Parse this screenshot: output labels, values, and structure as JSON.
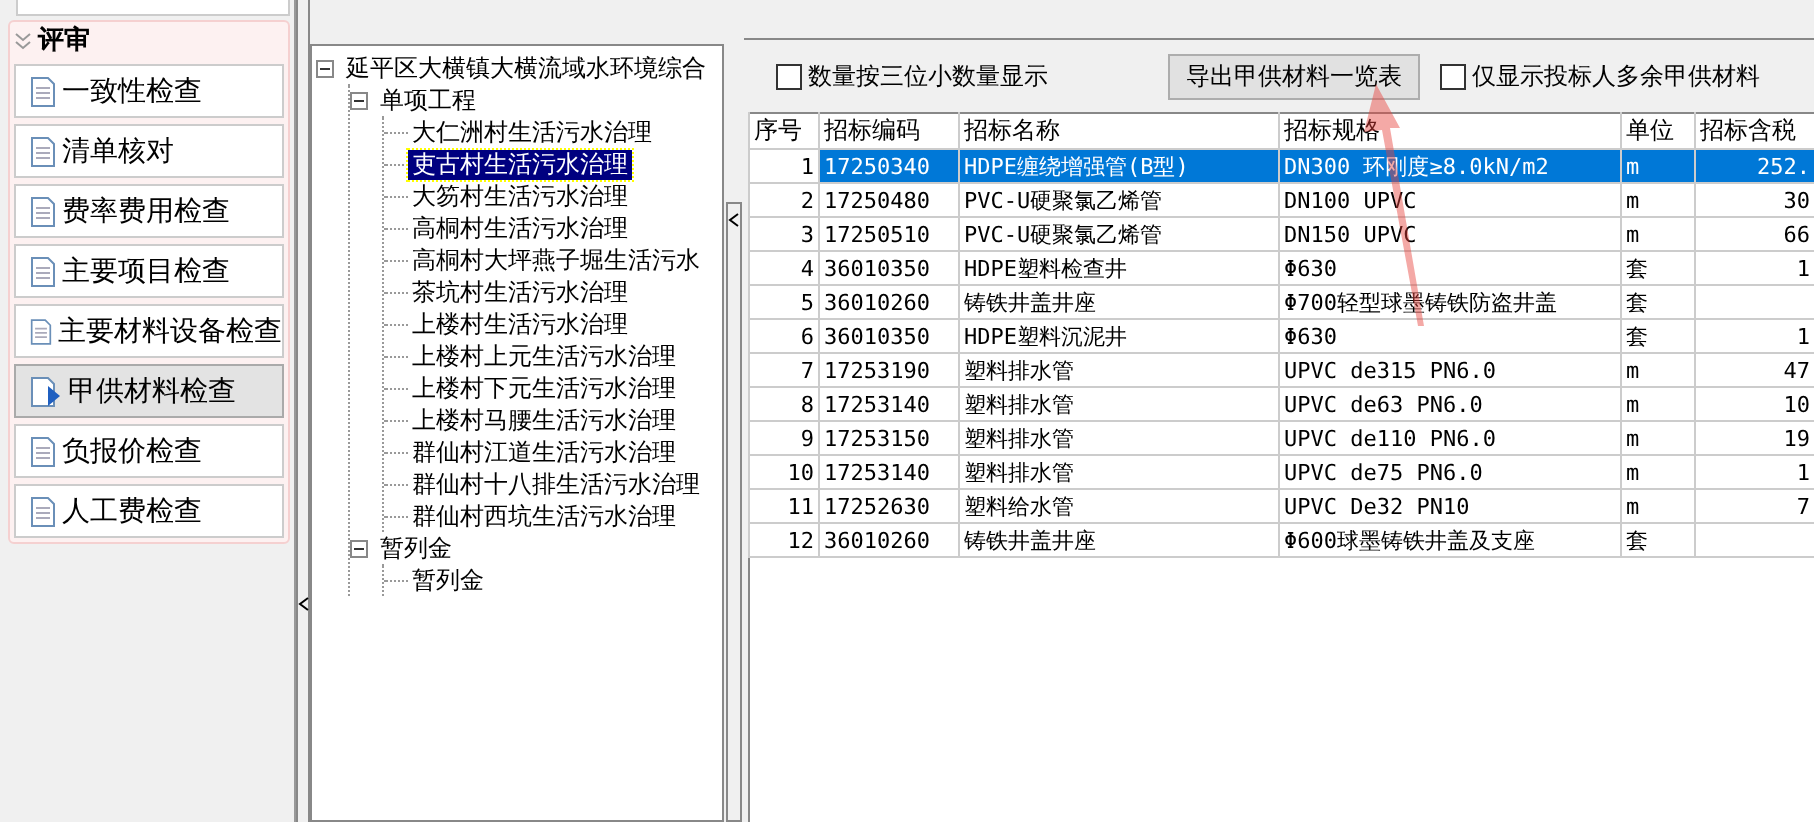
{
  "sidebar": {
    "section": "评审",
    "items": [
      {
        "label": "一致性检查",
        "selected": false
      },
      {
        "label": "清单核对",
        "selected": false
      },
      {
        "label": "费率费用检查",
        "selected": false
      },
      {
        "label": "主要项目检查",
        "selected": false
      },
      {
        "label": "主要材料设备检查",
        "selected": false
      },
      {
        "label": "甲供材料检查",
        "selected": true
      },
      {
        "label": "负报价检查",
        "selected": false
      },
      {
        "label": "人工费检查",
        "selected": false
      }
    ]
  },
  "tree": [
    {
      "label": "延平区大横镇大横流域水环境综合",
      "expanded": true,
      "selected": false,
      "children": [
        {
          "label": "单项工程",
          "expanded": true,
          "selected": false,
          "children": [
            {
              "label": "大仁洲村生活污水治理",
              "selected": false
            },
            {
              "label": "吏古村生活污水治理",
              "selected": true
            },
            {
              "label": "大笏村生活污水治理",
              "selected": false
            },
            {
              "label": "高桐村生活污水治理",
              "selected": false
            },
            {
              "label": "高桐村大坪燕子堀生活污水",
              "selected": false
            },
            {
              "label": "茶坑村生活污水治理",
              "selected": false
            },
            {
              "label": "上楼村生活污水治理",
              "selected": false
            },
            {
              "label": "上楼村上元生活污水治理",
              "selected": false
            },
            {
              "label": "上楼村下元生活污水治理",
              "selected": false
            },
            {
              "label": "上楼村马腰生活污水治理",
              "selected": false
            },
            {
              "label": "群仙村江道生活污水治理",
              "selected": false
            },
            {
              "label": "群仙村十八排生活污水治理",
              "selected": false
            },
            {
              "label": "群仙村西坑生活污水治理",
              "selected": false
            }
          ]
        },
        {
          "label": "暂列金",
          "expanded": true,
          "selected": false,
          "children": [
            {
              "label": "暂列金",
              "selected": false
            }
          ]
        }
      ]
    }
  ],
  "toolbar": {
    "decimal_checkbox": {
      "label": "数量按三位小数量显示",
      "checked": false
    },
    "export_button": "导出甲供材料一览表",
    "surplus_checkbox": {
      "label": "仅显示投标人多余甲供材料",
      "checked": false
    }
  },
  "table": {
    "columns": [
      "序号",
      "招标编码",
      "招标名称",
      "招标规格",
      "单位",
      "招标含税"
    ],
    "rows": [
      {
        "selected": true,
        "cells": [
          "1",
          "17250340",
          "HDPE缠绕增强管(B型)",
          "DN300 环刚度≥8.0kN/m2",
          "m",
          "252."
        ]
      },
      {
        "selected": false,
        "cells": [
          "2",
          "17250480",
          "PVC-U硬聚氯乙烯管",
          "DN100 UPVC",
          "m",
          "30"
        ]
      },
      {
        "selected": false,
        "cells": [
          "3",
          "17250510",
          "PVC-U硬聚氯乙烯管",
          "DN150 UPVC",
          "m",
          "66"
        ]
      },
      {
        "selected": false,
        "cells": [
          "4",
          "36010350",
          "HDPE塑料检查井",
          "Φ630",
          "套",
          "1"
        ]
      },
      {
        "selected": false,
        "cells": [
          "5",
          "36010260",
          "铸铁井盖井座",
          "Φ700轻型球墨铸铁防盗井盖",
          "套",
          ""
        ]
      },
      {
        "selected": false,
        "cells": [
          "6",
          "36010350",
          "HDPE塑料沉泥井",
          "Φ630",
          "套",
          "1"
        ]
      },
      {
        "selected": false,
        "cells": [
          "7",
          "17253190",
          "塑料排水管",
          "UPVC de315 PN6.0",
          "m",
          "47"
        ]
      },
      {
        "selected": false,
        "cells": [
          "8",
          "17253140",
          "塑料排水管",
          "UPVC de63 PN6.0",
          "m",
          "10"
        ]
      },
      {
        "selected": false,
        "cells": [
          "9",
          "17253150",
          "塑料排水管",
          "UPVC de110 PN6.0",
          "m",
          "19"
        ]
      },
      {
        "selected": false,
        "cells": [
          "10",
          "17253140",
          "塑料排水管",
          "UPVC de75 PN6.0",
          "m",
          "1"
        ]
      },
      {
        "selected": false,
        "cells": [
          "11",
          "17252630",
          "塑料给水管",
          "UPVC De32 PN10",
          "m",
          "7"
        ]
      },
      {
        "selected": false,
        "cells": [
          "12",
          "36010260",
          "铸铁井盖井座",
          "Φ600球墨铸铁井盖及支座",
          "套",
          ""
        ]
      }
    ]
  }
}
